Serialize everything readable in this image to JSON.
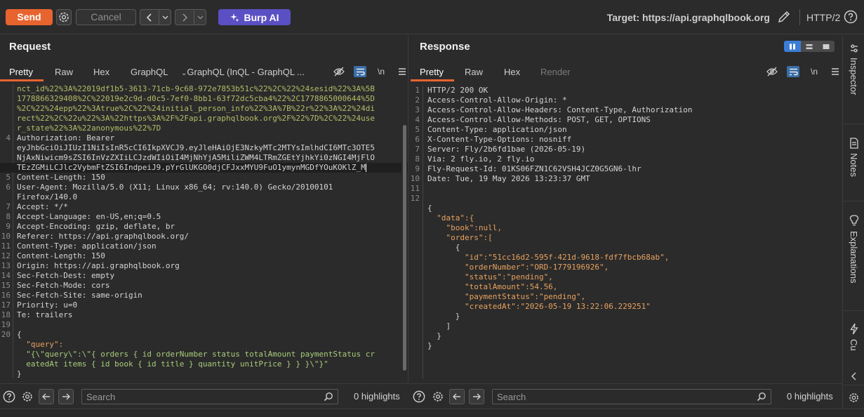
{
  "toolbar": {
    "send_label": "Send",
    "cancel_label": "Cancel",
    "burp_ai_label": "Burp AI",
    "target_label": "Target: https://api.graphqlbook.org",
    "protocol_label": "HTTP/2"
  },
  "request": {
    "title": "Request",
    "tabs": [
      "Pretty",
      "Raw",
      "Hex",
      "GraphQL",
      "GraphQL (InQL - GraphQL ..."
    ],
    "lines": [
      {
        "n": "",
        "t": "nct_id%22%3A%22019df1b5-3613-71cb-9c68-972e7853b51c%22%2C%22%24sesid%22%3A%5B",
        "c": "c-green"
      },
      {
        "n": "",
        "t": "1778866329408%2C%22019e2c9d-d0c5-7ef0-8bb1-63f72dc5cba4%22%2C1778865000644%5D",
        "c": "c-green"
      },
      {
        "n": "",
        "t": "%2C%22%24epp%22%3Atrue%2C%22%24initial_person_info%22%3A%7B%22r%22%3A%22%24di",
        "c": "c-green"
      },
      {
        "n": "",
        "t": "rect%22%2C%22u%22%3A%22https%3A%2F%2Fapi.graphqlbook.org%2F%22%7D%2C%22%24use",
        "c": "c-green"
      },
      {
        "n": "",
        "t": "r_state%22%3A%22anonymous%22%7D",
        "c": "c-green"
      },
      {
        "n": "4",
        "t": "Authorization: Bearer",
        "c": "c-val"
      },
      {
        "n": "",
        "t": "eyJhbGciOiJIUzI1NiIsInR5cCI6IkpXVCJ9.eyJleHAiOjE3NzkyMTc2MTYsImlhdCI6MTc3OTE5",
        "c": "c-val"
      },
      {
        "n": "",
        "t": "NjAxNiwicm9sZSI6InVzZXIiLCJzdWIiOiI4MjNhYjA5MiliZWM4LTRmZGEtYjhkYi0zNGI4MjFlO",
        "c": "c-val"
      },
      {
        "n": "",
        "t": "TEzZGMiLCJlc2VybmFtZSI6IndpeiJ9.pYrGlUKGO0djCFJxxMYU9FuO1ymynMGDfYOuKOKlZ_M",
        "c": "c-val",
        "cursor": true,
        "sel": true
      },
      {
        "n": "5",
        "t": "Content-Length: 150",
        "c": "c-val"
      },
      {
        "n": "6",
        "t": "User-Agent: Mozilla/5.0 (X11; Linux x86_64; rv:140.0) Gecko/20100101",
        "c": "c-val"
      },
      {
        "n": "",
        "t": "Firefox/140.0",
        "c": "c-val"
      },
      {
        "n": "7",
        "t": "Accept: */*",
        "c": "c-val"
      },
      {
        "n": "8",
        "t": "Accept-Language: en-US,en;q=0.5",
        "c": "c-val"
      },
      {
        "n": "9",
        "t": "Accept-Encoding: gzip, deflate, br",
        "c": "c-val"
      },
      {
        "n": "10",
        "t": "Referer: https://api.graphqlbook.org/",
        "c": "c-val"
      },
      {
        "n": "11",
        "t": "Content-Type: application/json",
        "c": "c-val"
      },
      {
        "n": "12",
        "t": "Content-Length: 150",
        "c": "c-val"
      },
      {
        "n": "13",
        "t": "Origin: https://api.graphqlbook.org",
        "c": "c-val"
      },
      {
        "n": "14",
        "t": "Sec-Fetch-Dest: empty",
        "c": "c-val"
      },
      {
        "n": "15",
        "t": "Sec-Fetch-Mode: cors",
        "c": "c-val"
      },
      {
        "n": "16",
        "t": "Sec-Fetch-Site: same-origin",
        "c": "c-val"
      },
      {
        "n": "17",
        "t": "Priority: u=0",
        "c": "c-val"
      },
      {
        "n": "18",
        "t": "Te: trailers",
        "c": "c-val"
      },
      {
        "n": "19",
        "t": "",
        "c": "c-val"
      },
      {
        "n": "20",
        "t": "{",
        "c": "c-val"
      },
      {
        "n": "",
        "t": "  \"query\":",
        "c": "c-kw"
      },
      {
        "n": "",
        "t": "  \"{\\\"query\\\":\\\"{ orders { id orderNumber status totalAmount paymentStatus cr",
        "c": "c-str"
      },
      {
        "n": "",
        "t": "  eatedAt items { id book { id title } quantity unitPrice } } }\\\"}\"",
        "c": "c-str"
      },
      {
        "n": "",
        "t": "}",
        "c": "c-val"
      }
    ],
    "search_placeholder": "Search",
    "highlights": "0 highlights"
  },
  "response": {
    "title": "Response",
    "tabs": [
      "Pretty",
      "Raw",
      "Hex",
      "Render"
    ],
    "lines": [
      {
        "n": "1",
        "t": "HTTP/2 200 OK",
        "c": "c-val"
      },
      {
        "n": "2",
        "t": "Access-Control-Allow-Origin: *",
        "c": "c-val"
      },
      {
        "n": "3",
        "t": "Access-Control-Allow-Headers: Content-Type, Authorization",
        "c": "c-val"
      },
      {
        "n": "4",
        "t": "Access-Control-Allow-Methods: POST, GET, OPTIONS",
        "c": "c-val"
      },
      {
        "n": "5",
        "t": "Content-Type: application/json",
        "c": "c-val"
      },
      {
        "n": "6",
        "t": "X-Content-Type-Options: nosniff",
        "c": "c-val"
      },
      {
        "n": "7",
        "t": "Server: Fly/2b6fd1bae (2026-05-19)",
        "c": "c-val"
      },
      {
        "n": "8",
        "t": "Via: 2 fly.io, 2 fly.io",
        "c": "c-val"
      },
      {
        "n": "9",
        "t": "Fly-Request-Id: 01KS06FZN1C62VSH4JCZ0G5GN6-lhr",
        "c": "c-val"
      },
      {
        "n": "10",
        "t": "Date: Tue, 19 May 2026 13:23:37 GMT",
        "c": "c-val"
      },
      {
        "n": "11",
        "t": "",
        "c": "c-val"
      },
      {
        "n": "12",
        "t": "",
        "c": "c-val"
      },
      {
        "n": "",
        "t": "{",
        "c": "c-val"
      },
      {
        "n": "",
        "t": "  \"data\":{",
        "c": "c-kw"
      },
      {
        "n": "",
        "t": "    \"book\":null,",
        "c": "c-kw"
      },
      {
        "n": "",
        "t": "    \"orders\":[",
        "c": "c-kw"
      },
      {
        "n": "",
        "t": "      {",
        "c": "c-val"
      },
      {
        "n": "",
        "t": "        \"id\":\"51cc16d2-595f-421d-9618-fdf7fbcb68ab\",",
        "c": "c-kw"
      },
      {
        "n": "",
        "t": "        \"orderNumber\":\"ORD-1779196926\",",
        "c": "c-kw"
      },
      {
        "n": "",
        "t": "        \"status\":\"pending\",",
        "c": "c-kw"
      },
      {
        "n": "",
        "t": "        \"totalAmount\":54.56,",
        "c": "c-kw"
      },
      {
        "n": "",
        "t": "        \"paymentStatus\":\"pending\",",
        "c": "c-kw"
      },
      {
        "n": "",
        "t": "        \"createdAt\":\"2026-05-19 13:22:06.229251\"",
        "c": "c-kw"
      },
      {
        "n": "",
        "t": "      }",
        "c": "c-val"
      },
      {
        "n": "",
        "t": "    ]",
        "c": "c-val"
      },
      {
        "n": "",
        "t": "  }",
        "c": "c-val"
      },
      {
        "n": "",
        "t": "}",
        "c": "c-val"
      }
    ],
    "search_placeholder": "Search",
    "highlights": "0 highlights"
  },
  "rail": {
    "items": [
      "Inspector",
      "Notes",
      "Explanations",
      "Cu"
    ]
  },
  "colors": {
    "send": "#e8642f",
    "burp_ai": "#5b4fc4",
    "tab_underline": "#e8642f",
    "toggle_on": "#3b7dd8"
  }
}
